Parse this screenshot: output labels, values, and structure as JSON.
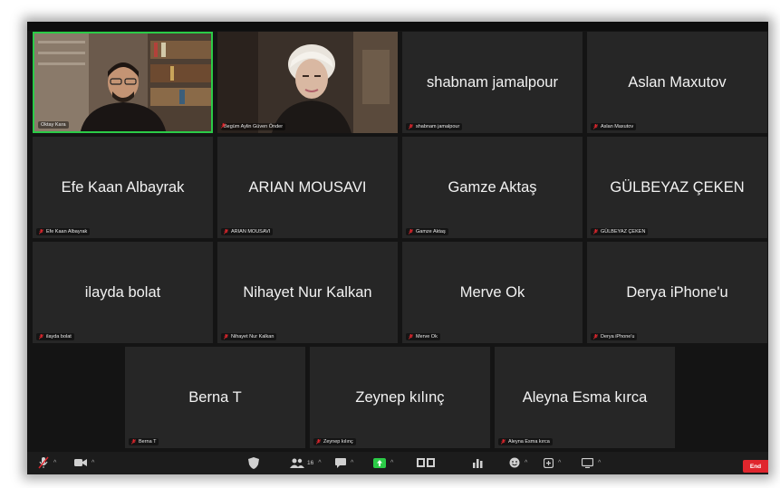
{
  "participants": [
    {
      "label": "Oktay Kara",
      "video": true,
      "active": true,
      "muted": false
    },
    {
      "label": "Begüm Aylin Güven Önder",
      "video": true,
      "muted": true
    },
    {
      "name": "shabnam jamalpour",
      "label": "shabnam jamalpour",
      "muted": true
    },
    {
      "name": "Aslan Maxutov",
      "label": "Aslan Maxutov",
      "muted": true
    },
    {
      "name": "Efe Kaan Albayrak",
      "label": "Efe Kaan Albayrak",
      "muted": true
    },
    {
      "name": "ARIAN MOUSAVI",
      "label": "ARIAN MOUSAVI",
      "muted": true
    },
    {
      "name": "Gamze Aktaş",
      "label": "Gamze Aktaş",
      "muted": true
    },
    {
      "name": "GÜLBEYAZ ÇEKEN",
      "label": "GÜLBEYAZ ÇEKEN",
      "muted": true
    },
    {
      "name": "ilayda bolat",
      "label": "ilayda bolat",
      "muted": true
    },
    {
      "name": "Nihayet Nur Kalkan",
      "label": "Nihayet Nur Kalkan",
      "muted": true
    },
    {
      "name": "Merve Ok",
      "label": "Merve Ok",
      "muted": true
    },
    {
      "name": "Derya iPhone'u",
      "label": "Derya iPhone'u",
      "muted": true
    },
    {
      "name": "Berna T",
      "label": "Berna T",
      "muted": true
    },
    {
      "name": "Zeynep kılınç",
      "label": "Zeynep kılınç",
      "muted": true
    },
    {
      "name": "Aleyna Esma kırca",
      "label": "Aleyna Esma kırca",
      "muted": true
    }
  ],
  "toolbar": {
    "participants_count": "16",
    "end_label": "End",
    "icons": [
      "microphone-icon",
      "video-camera-icon",
      "security-icon",
      "participants-icon",
      "chat-icon",
      "share-screen-icon",
      "breakout-rooms-icon",
      "polls-icon",
      "reactions-icon",
      "apps-icon",
      "view-icon"
    ]
  },
  "colors": {
    "tile_bg": "#262626",
    "active_border": "#2bcb47",
    "muted_icon": "#e0262d",
    "end_button": "#e0262d",
    "share_green": "#2bcb47"
  }
}
